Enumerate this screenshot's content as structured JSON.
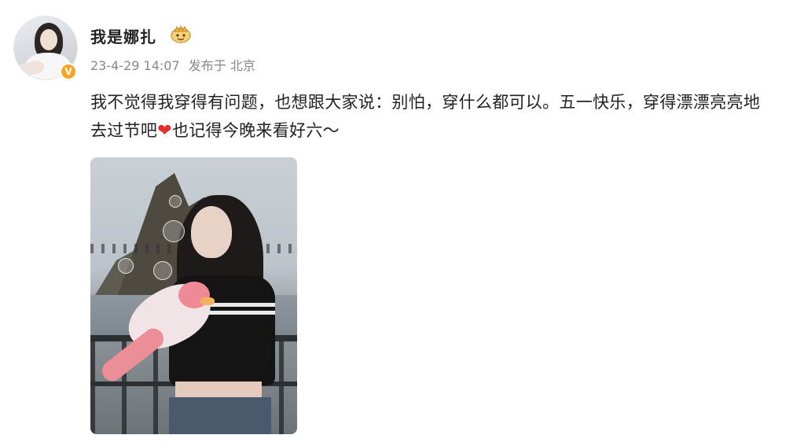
{
  "post": {
    "username": "我是娜扎",
    "date": "23-4-29 14:07",
    "posted_from": "发布于 北京",
    "content_before_emoji": "我不觉得我穿得有问题，也想跟大家说：别怕，穿什么都可以。五一快乐，穿得漂漂亮亮地去过节吧",
    "emoji": "❤",
    "content_after_emoji": "也记得今晚来看好六～"
  },
  "icons": {
    "avatar": "user-avatar",
    "verified": "verified-badge-icon",
    "member_badge": "crown-badge-icon",
    "heart": "red-heart-icon"
  },
  "colors": {
    "verified": "#f6a623",
    "heart": "#e62c2c",
    "meta_text": "#888888",
    "body_text": "#222222"
  }
}
